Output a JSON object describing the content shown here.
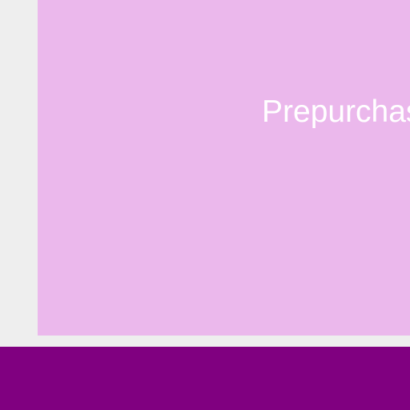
{
  "card": {
    "label": "Prepurchas"
  },
  "colors": {
    "background": "#eeeeee",
    "card": "#ebb8ec",
    "label_text": "#ffffff",
    "bottom_bar": "#800080"
  }
}
